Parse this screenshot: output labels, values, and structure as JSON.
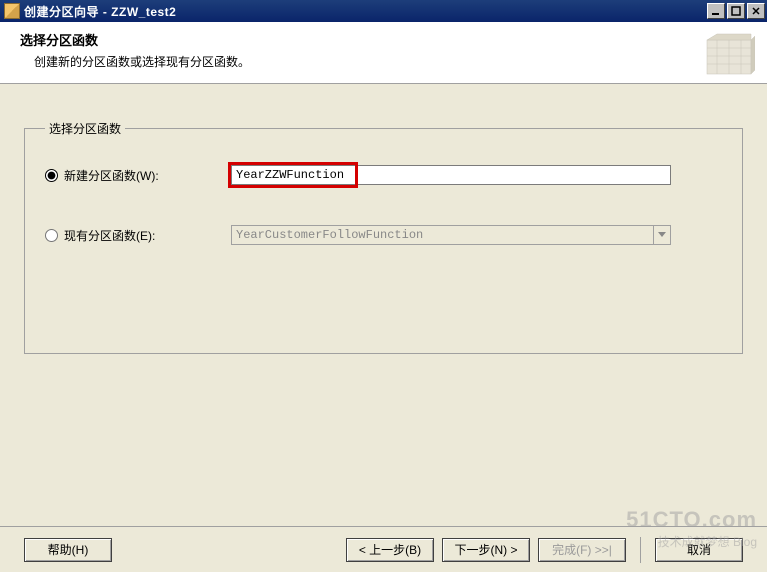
{
  "window": {
    "title": "创建分区向导 - ZZW_test2"
  },
  "header": {
    "title": "选择分区函数",
    "subtitle": "创建新的分区函数或选择现有分区函数。"
  },
  "group": {
    "legend": "选择分区函数",
    "radio_new_label": "新建分区函数(W):",
    "new_function_value": "YearZZWFunction",
    "radio_existing_label": "现有分区函数(E):",
    "existing_function_value": "YearCustomerFollowFunction"
  },
  "footer": {
    "help": "帮助(H)",
    "back": "< 上一步(B)",
    "next": "下一步(N) >",
    "finish": "完成(F) >>|",
    "cancel": "取消"
  },
  "watermark": {
    "big": "51CTO.com",
    "small": "技术成就梦想  Blog"
  }
}
